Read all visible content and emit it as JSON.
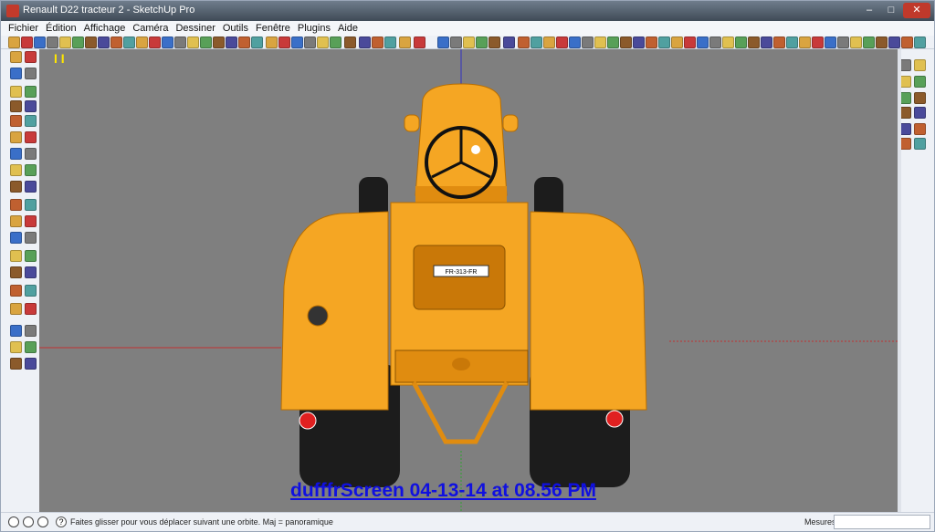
{
  "window": {
    "title": "Renault D22 tracteur 2 - SketchUp Pro",
    "controls": [
      "–",
      "□",
      "✕"
    ]
  },
  "menu": [
    "Fichier",
    "Édition",
    "Affichage",
    "Caméra",
    "Dessiner",
    "Outils",
    "Fenêtre",
    "Plugins",
    "Aide"
  ],
  "viewport": {
    "plate": "FR-313-FR",
    "watermark": "dufffrScreen 04-13-14 at 08.56 PM",
    "pause_indicator": "I I",
    "tractor_color": "#f5a623"
  },
  "status": {
    "message": "Faites glisser pour vous déplacer suivant une orbite. Maj = panoramique",
    "help_icon": "?",
    "measure_label": "Mesures",
    "measure_value": ""
  },
  "colors": {
    "background": "#7f7f7f",
    "tractor": "#f5a623",
    "watermark": "#1010e0"
  }
}
